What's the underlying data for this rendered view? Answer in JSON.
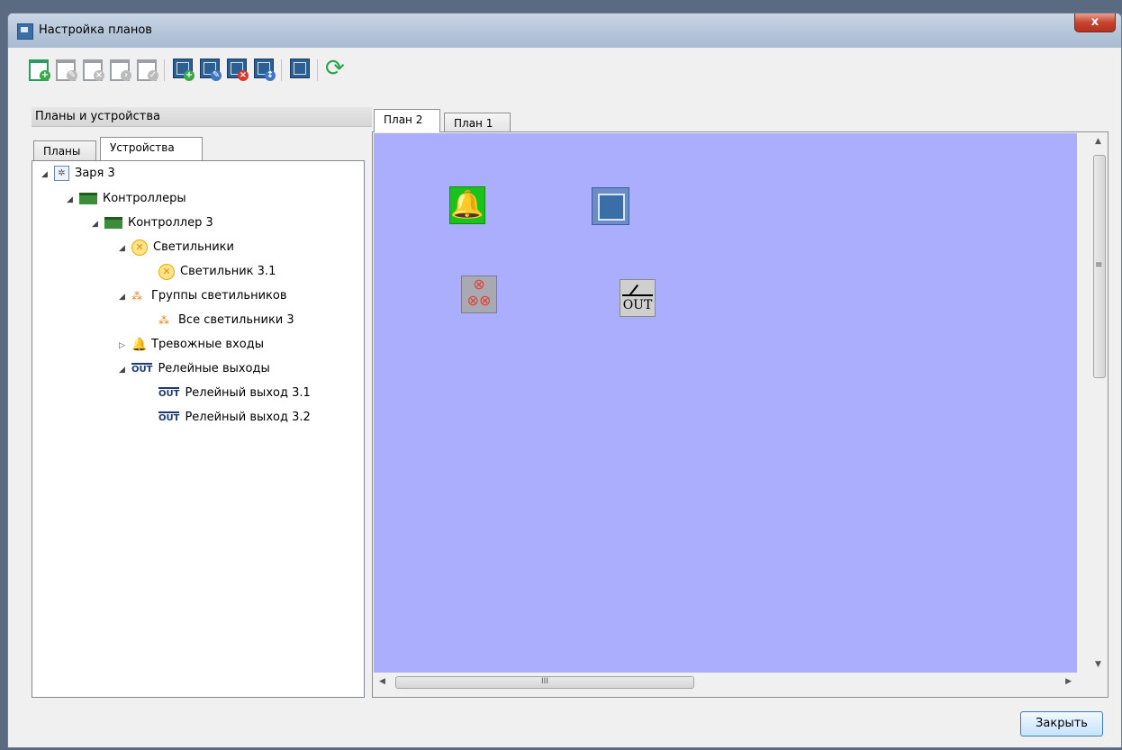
{
  "window": {
    "title": "Настройка планов",
    "close_glyph": "x"
  },
  "toolbar": {
    "buttons": [
      {
        "icon": "add-plan-icon"
      },
      {
        "icon": "edit-plan-icon"
      },
      {
        "icon": "delete-plan-icon"
      },
      {
        "icon": "add-subplan-icon"
      },
      {
        "icon": "plan-properties-icon"
      },
      {
        "icon": "add-element-icon"
      },
      {
        "icon": "edit-element-icon"
      },
      {
        "icon": "remove-element-icon"
      },
      {
        "icon": "move-element-icon"
      },
      {
        "icon": "plan-image-icon"
      },
      {
        "icon": "refresh-icon"
      }
    ]
  },
  "left_panel": {
    "header": "Планы и устройства",
    "tabs": [
      "Планы",
      "Устройства"
    ],
    "active_tab": "Устройства",
    "tree": [
      {
        "label": "Заря 3",
        "icon": "device-gear-icon",
        "expanded": true
      },
      {
        "label": "Контроллеры",
        "icon": "controller-board-icon",
        "expanded": true
      },
      {
        "label": "Контроллер 3",
        "icon": "controller-board-icon",
        "expanded": true
      },
      {
        "label": "Светильники",
        "icon": "lamp-icon",
        "expanded": true
      },
      {
        "label": "Светильник 3.1",
        "icon": "lamp-icon"
      },
      {
        "label": "Группы светильников",
        "icon": "lamp-group-icon",
        "expanded": true
      },
      {
        "label": "Все светильники 3",
        "icon": "lamp-group-icon"
      },
      {
        "label": "Тревожные входы",
        "icon": "bell-icon",
        "expanded": false
      },
      {
        "label": "Релейные выходы",
        "icon": "relay-out-icon",
        "expanded": true
      },
      {
        "label": "Релейный выход 3.1",
        "icon": "relay-out-icon"
      },
      {
        "label": "Релейный выход 3.2",
        "icon": "relay-out-icon"
      }
    ]
  },
  "plan_tabs": [
    "План 2",
    "План 1"
  ],
  "active_plan_tab": "План 2",
  "canvas": {
    "background": "#aaaefd",
    "devices": [
      {
        "type": "alarm-bell",
        "icon": "bell-icon"
      },
      {
        "type": "controller",
        "icon": "plan-link-icon"
      },
      {
        "type": "lamp-group",
        "icon": "lamp-group-icon"
      },
      {
        "type": "relay-output",
        "icon": "relay-out-icon",
        "label": "OUT"
      }
    ]
  },
  "scroll": {
    "h_thumb_label": "III",
    "v_thumb_label": "≡"
  },
  "footer": {
    "close_label": "Закрыть"
  }
}
